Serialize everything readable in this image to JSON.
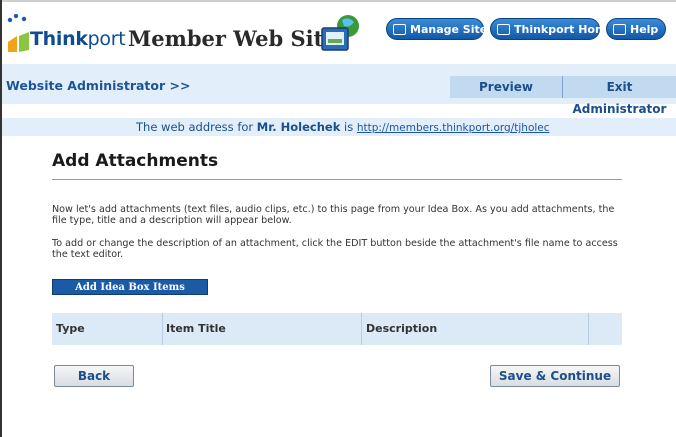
{
  "header": {
    "logo_think": "Think",
    "logo_port": "port",
    "site_title": "Member Web Site",
    "buttons": {
      "manage": "Manage Site",
      "home": "Thinkport Home",
      "help": "Help"
    }
  },
  "admin_bar": {
    "title": "Website Administrator >>",
    "tabs": {
      "preview": "Preview",
      "exit": "Exit Administrator"
    }
  },
  "address": {
    "prefix": "The web address for",
    "name": "Mr. Holechek",
    "is": "is",
    "url": "http://members.thinkport.org/tjholec"
  },
  "main": {
    "title": "Add Attachments",
    "paragraph1": "Now let's add attachments (text files, audio clips, etc.) to this page from your Idea Box. As you add attachments, the file type, title and a description will appear below.",
    "paragraph2": "To add or change the description of an attachment, click the EDIT button beside the attachment's file name to access the text editor.",
    "add_button": "Add Idea Box Items",
    "table_headers": [
      "Type",
      "Item Title",
      "Description",
      ""
    ],
    "back_button": "Back",
    "save_button": "Save & Continue"
  },
  "colors": {
    "accent": "#1b5aa5",
    "admin_bar_bg": "#e2eef9",
    "table_header_bg": "#dce9f6"
  }
}
